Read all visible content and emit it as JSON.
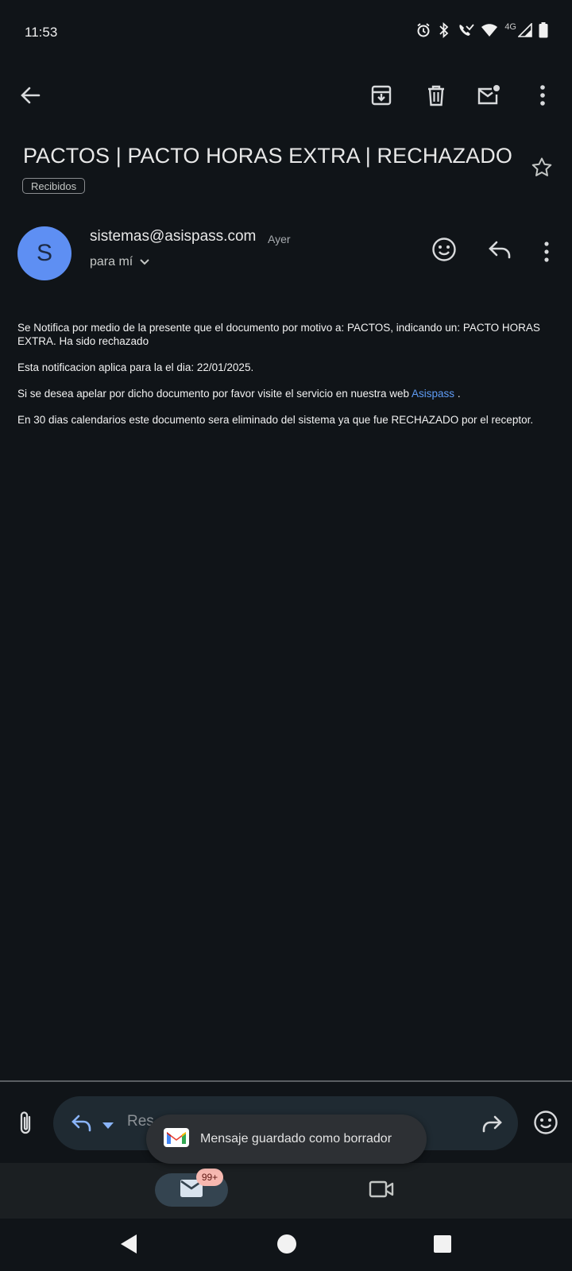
{
  "status_bar": {
    "time": "11:53",
    "network": "4G",
    "icons": [
      "alarm-icon",
      "bluetooth-icon",
      "wifi-call-icon",
      "wifi-icon",
      "signal-icon",
      "battery-icon"
    ]
  },
  "toolbar": {
    "icons": [
      "back-arrow-icon",
      "archive-icon",
      "delete-icon",
      "mark-unread-icon",
      "more-vert-icon"
    ]
  },
  "email": {
    "subject": "PACTOS | PACTO HORAS EXTRA | RECHAZADO",
    "label": "Recibidos",
    "avatar_letter": "S",
    "sender": "sistemas@asispass.com",
    "when": "Ayer",
    "to": "para mí",
    "body": {
      "p1": "Se Notifica por medio de la presente que el documento por motivo a: PACTOS, indicando un: PACTO HORAS EXTRA. Ha sido rechazado",
      "p2": "Esta notificacion aplica para la el dia: 22/01/2025.",
      "p3_before": "Si se desea apelar por dicho documento por favor visite el servicio en nuestra web ",
      "p3_link": "Asispass",
      "p3_after": " .",
      "p4": "En 30 dias calendarios este documento sera eliminado del sistema ya que fue RECHAZADO por el receptor."
    }
  },
  "reply_bar": {
    "placeholder": "Res"
  },
  "toast": {
    "text": "Mensaje guardado como borrador"
  },
  "bottom_nav": {
    "badge": "99+"
  },
  "colors": {
    "background": "#101418",
    "avatar": "#5e8ff3",
    "link": "#5f9cf5",
    "badge": "#f6b8b0"
  }
}
